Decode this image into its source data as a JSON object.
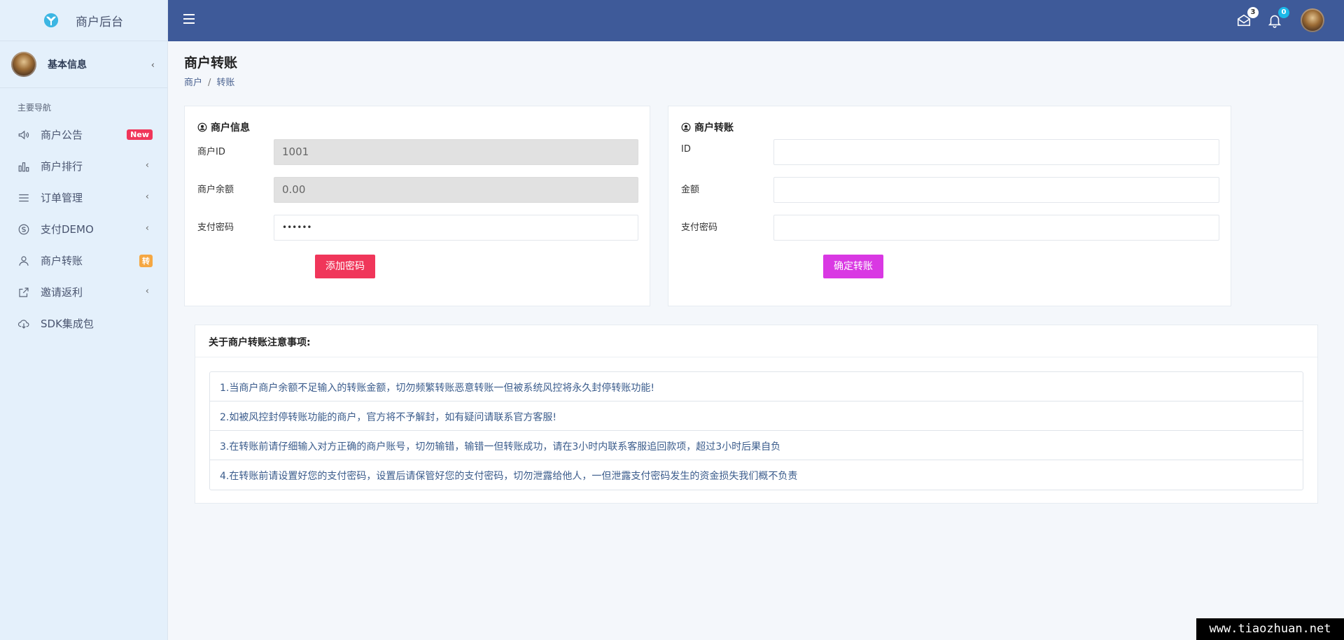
{
  "brand": {
    "name": "商户后台"
  },
  "user": {
    "name": "基本信息"
  },
  "nav": {
    "section_title": "主要导航",
    "items": [
      {
        "label": "商户公告",
        "badge": "New"
      },
      {
        "label": "商户排行"
      },
      {
        "label": "订单管理"
      },
      {
        "label": "支付DEMO"
      },
      {
        "label": "商户转账",
        "badge": "转"
      },
      {
        "label": "邀请返利"
      },
      {
        "label": "SDK集成包"
      }
    ]
  },
  "topbar": {
    "mail_count": "3",
    "bell_count": "0"
  },
  "page": {
    "title": "商户转账",
    "breadcrumb": [
      "商户",
      "转账"
    ]
  },
  "merchant_info": {
    "title": "商户信息",
    "id_label": "商户ID",
    "id_value": "1001",
    "balance_label": "商户余额",
    "balance_value": "0.00",
    "password_label": "支付密码",
    "password_value": "••••••",
    "button": "添加密码"
  },
  "transfer": {
    "title": "商户转账",
    "id_label": "ID",
    "amount_label": "金额",
    "password_label": "支付密码",
    "button": "确定转账"
  },
  "notice": {
    "title": "关于商户转账注意事项:",
    "items": [
      "1.当商户商户余额不足输入的转账金额，切勿频繁转账恶意转账一但被系统风控将永久封停转账功能!",
      "2.如被风控封停转账功能的商户，官方将不予解封，如有疑问请联系官方客服!",
      "3.在转账前请仔细输入对方正确的商户账号，切勿输错，输错一但转账成功，请在3小时内联系客服追回款项，超过3小时后果自负",
      "4.在转账前请设置好您的支付密码，设置后请保管好您的支付密码，切勿泄露给他人，一但泄露支付密码发生的资金损失我们概不负责"
    ]
  },
  "watermark": "www.tiaozhuan.net",
  "colors": {
    "topbar": "#3e5a99",
    "sidebar": "#e4f0fb",
    "btn_pink": "#f0365a",
    "btn_purple": "#d938e3"
  }
}
